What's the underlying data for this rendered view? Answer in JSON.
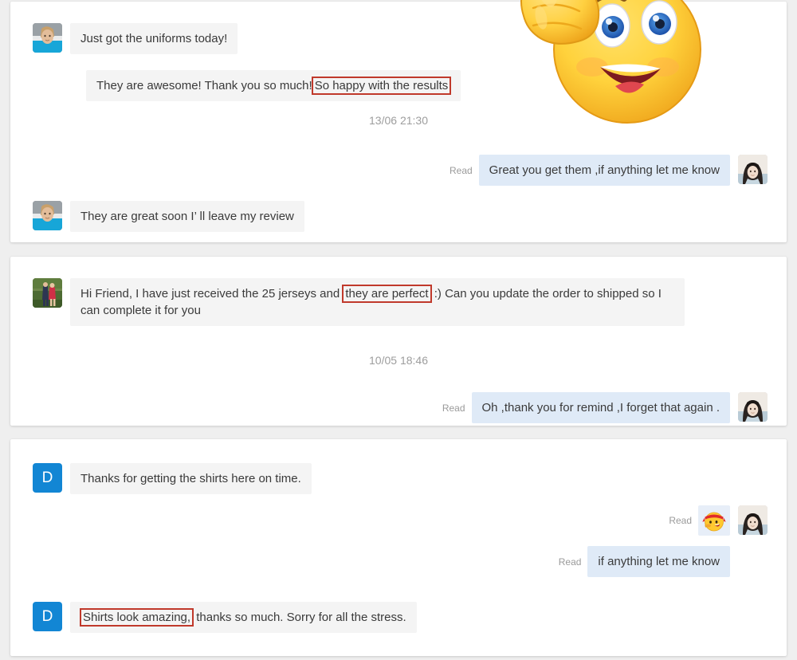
{
  "conversations": [
    {
      "id": "conversation-1",
      "messages": [
        {
          "direction": "incoming",
          "avatar": "woman-blue-top-avatar",
          "text": "Just got the uniforms today!"
        },
        {
          "direction": "incoming",
          "avatar": "none",
          "text_plain": "They are awesome! Thank you so much!",
          "text_highlighted": "So happy with the results"
        },
        {
          "direction": "timestamp",
          "text": "13/06 21:30"
        },
        {
          "direction": "outgoing",
          "read_label": "Read",
          "avatar": "dark-haired-woman-avatar",
          "text": "Great you get them ,if anything let me know"
        },
        {
          "direction": "incoming",
          "avatar": "woman-blue-top-avatar",
          "text": "They are great soon I’ ll leave my review"
        }
      ],
      "sticker": {
        "name": "thumbs-up-smiley-sticker",
        "description": "Large yellow smiley face giving a thumbs up"
      }
    },
    {
      "id": "conversation-2",
      "messages": [
        {
          "direction": "incoming",
          "avatar": "couple-outdoors-avatar",
          "text_before": "Hi Friend, I have just received the 25 jerseys and ",
          "text_highlighted": "they are perfect",
          "text_after": " :) Can you update the order to shipped so I can complete it for you"
        },
        {
          "direction": "timestamp",
          "text": "10/05 18:46"
        },
        {
          "direction": "outgoing",
          "read_label": "Read",
          "avatar": "dark-haired-woman-avatar",
          "text": "Oh ,thank you for remind ,I forget that again ."
        }
      ]
    },
    {
      "id": "conversation-3",
      "messages": [
        {
          "direction": "incoming",
          "avatar": "letter-d-avatar",
          "avatar_letter": "D",
          "text": "Thanks for getting the shirts here on time."
        },
        {
          "direction": "outgoing",
          "read_label": "Read",
          "avatar": "dark-haired-woman-avatar",
          "emoji": "determined-headband-emoji"
        },
        {
          "direction": "outgoing",
          "read_label": "Read",
          "avatar": "none",
          "text": "if anything let me know"
        },
        {
          "direction": "incoming",
          "avatar": "letter-d-avatar",
          "avatar_letter": "D",
          "text_highlighted": "Shirts look amazing,",
          "text_after": " thanks so much. Sorry for all the stress."
        }
      ]
    }
  ],
  "labels": {
    "read": "Read"
  },
  "colors": {
    "page_background": "#efefef",
    "card_background": "#ffffff",
    "incoming_bubble": "#f4f4f4",
    "outgoing_bubble": "#dfeaf7",
    "highlight_border": "#c0392b",
    "avatar_letter_background": "#1286d4",
    "timestamp_text": "#9d9d9d",
    "read_text": "#9a9a9a",
    "message_text": "#3a3a3a"
  }
}
